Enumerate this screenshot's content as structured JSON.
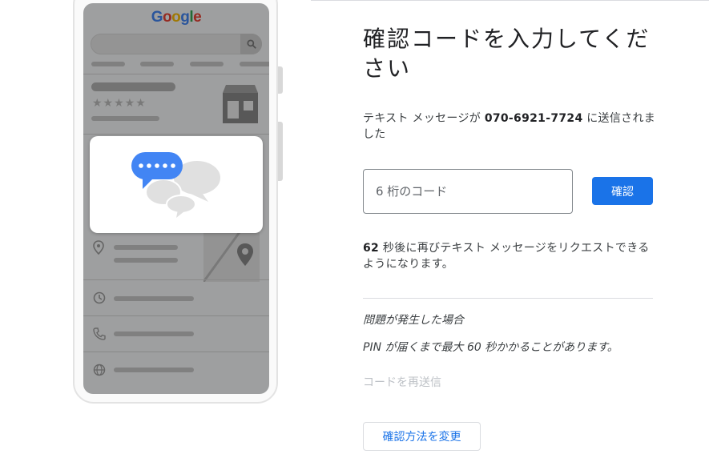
{
  "illustration": {
    "logo_text": "Google",
    "logo_colors": [
      "#4285f4",
      "#ea4335",
      "#fbbc05",
      "#4285f4",
      "#34a853",
      "#ea4335"
    ]
  },
  "verify": {
    "title": "確認コードを入力してください",
    "sent_prefix": "テキスト メッセージが ",
    "phone_number": "070-6921-7724",
    "sent_suffix": " に送信されました",
    "code_placeholder": "6 桁のコード",
    "code_value": "",
    "confirm_label": "確認",
    "countdown_seconds": "62",
    "countdown_text": " 秒後に再びテキスト メッセージをリクエストできるようになります。",
    "trouble_heading": "問題が発生した場合",
    "trouble_text": "PIN が届くまで最大 60 秒かかることがあります。",
    "resend_label": "コードを再送信",
    "change_method_label": "確認方法を変更"
  },
  "colors": {
    "accent": "#1a73e8",
    "disabled_text": "#bdc1c6",
    "bubble_blue": "#4285f4",
    "bubble_grey": "#e0e0e0"
  }
}
